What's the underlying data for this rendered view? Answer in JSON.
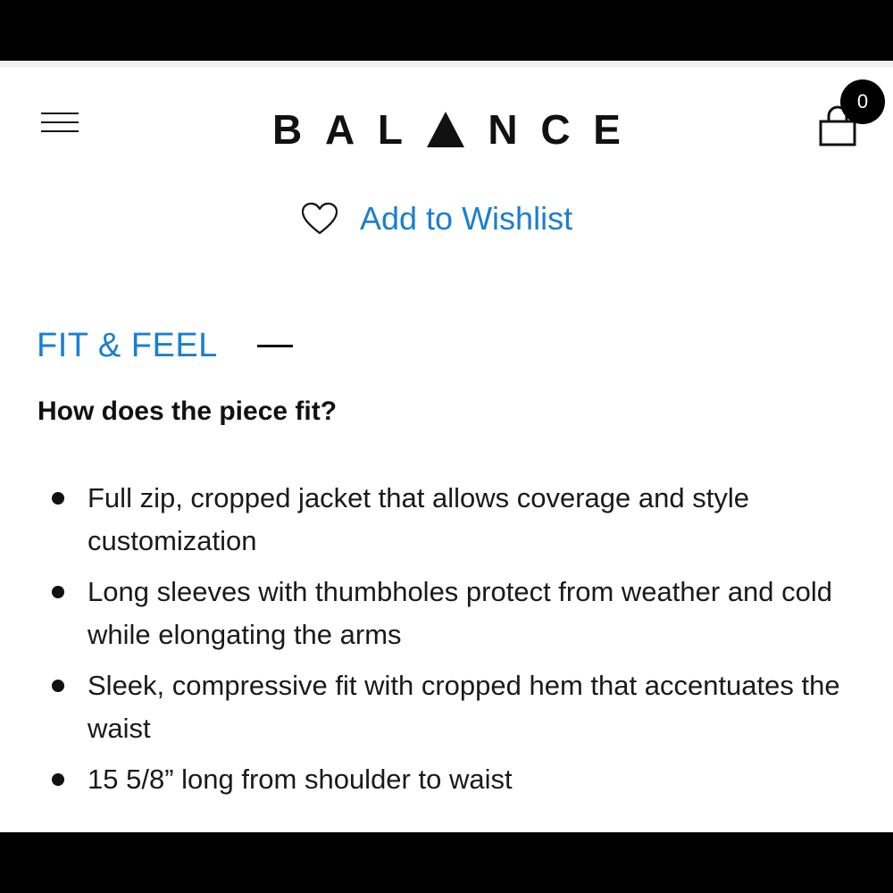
{
  "header": {
    "logo_letters": [
      "B",
      "A",
      "L",
      "",
      "N",
      "C",
      "E"
    ],
    "logo_text": "BALANCE",
    "menu_icon": "hamburger-icon",
    "bag_icon": "shopping-bag-icon",
    "bag_count": "0"
  },
  "wishlist": {
    "icon": "heart-icon",
    "label": "Add to Wishlist"
  },
  "section": {
    "title": "FIT & FEEL",
    "toggle_icon": "minus-icon",
    "question": "How does the piece fit?",
    "bullets": [
      "Full zip, cropped jacket that allows coverage and style customization",
      "Long sleeves with thumbholes protect from weather and cold while elongating the arms",
      "Sleek, compressive fit with cropped hem that accentuates the waist",
      "15 5/8” long from shoulder to waist"
    ]
  },
  "colors": {
    "accent": "#1a7fd1",
    "text": "#111111",
    "background": "#ffffff"
  }
}
